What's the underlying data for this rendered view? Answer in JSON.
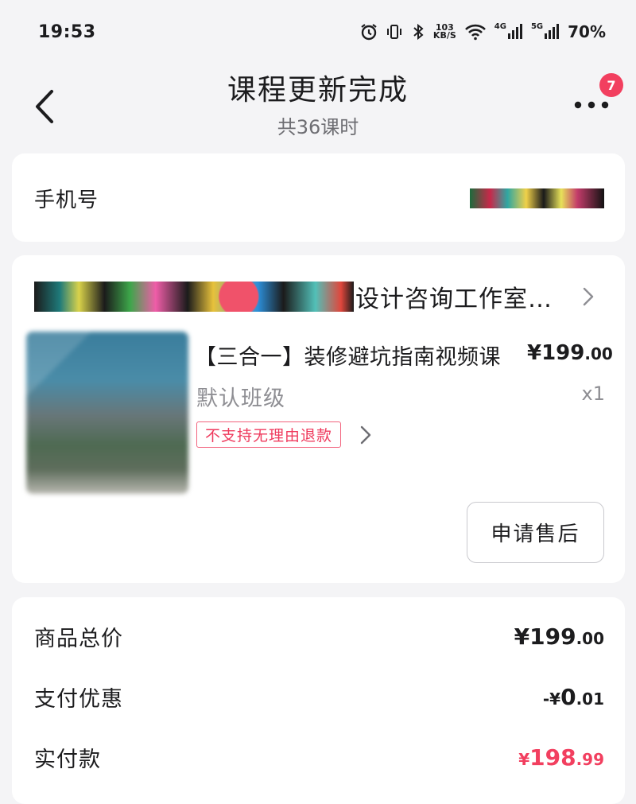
{
  "status_bar": {
    "time": "19:53",
    "net_speed_top": "103",
    "net_speed_bottom": "KB/S",
    "sig1_label": "4G",
    "sig2_label": "5G",
    "battery": "70%",
    "icons": [
      "alarm-icon",
      "vibrate-icon",
      "bluetooth-icon",
      "wifi-icon",
      "signal-icon"
    ]
  },
  "header": {
    "title": "课程更新完成",
    "subtitle": "共36课时",
    "badge_count": "7"
  },
  "contact": {
    "label": "手机号"
  },
  "shop": {
    "name": "设计咨询工作室…"
  },
  "course": {
    "title": "【三合一】装修避坑指南视频课",
    "price_int": "¥199",
    "price_dec": ".00",
    "class_name": "默认班级",
    "quantity": "x1",
    "refund_tag": "不支持无理由退款",
    "after_sale_label": "申请售后"
  },
  "summary": {
    "total_label": "商品总价",
    "total_int": "¥199",
    "total_dec": ".00",
    "discount_label": "支付优惠",
    "discount_cur": "-¥",
    "discount_int": "0",
    "discount_dec": ".01",
    "paid_label": "实付款",
    "paid_cur": "¥",
    "paid_int": "198",
    "paid_dec": ".99"
  },
  "colors": {
    "accent": "#f23f5f",
    "background": "#f4f4f6",
    "card": "#ffffff",
    "muted_text": "#8e8e93"
  }
}
